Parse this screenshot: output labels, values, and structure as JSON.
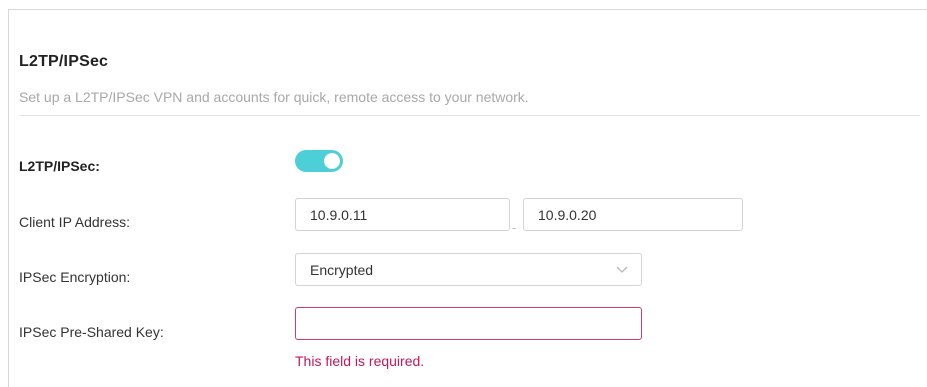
{
  "section": {
    "title": "L2TP/IPSec",
    "description": "Set up a L2TP/IPSec VPN and accounts for quick, remote access to your network."
  },
  "form": {
    "enable_label": "L2TP/IPSec:",
    "enable_state": true,
    "client_ip_label": "Client IP Address:",
    "client_ip_start": "10.9.0.11",
    "client_ip_separator": "-",
    "client_ip_end": "10.9.0.20",
    "encryption_label": "IPSec Encryption:",
    "encryption_value": "Encrypted",
    "psk_label": "IPSec Pre-Shared Key:",
    "psk_value": "",
    "psk_error": "This field is required."
  },
  "colors": {
    "toggle_on": "#4ccfd7",
    "error": "#c2185b"
  }
}
